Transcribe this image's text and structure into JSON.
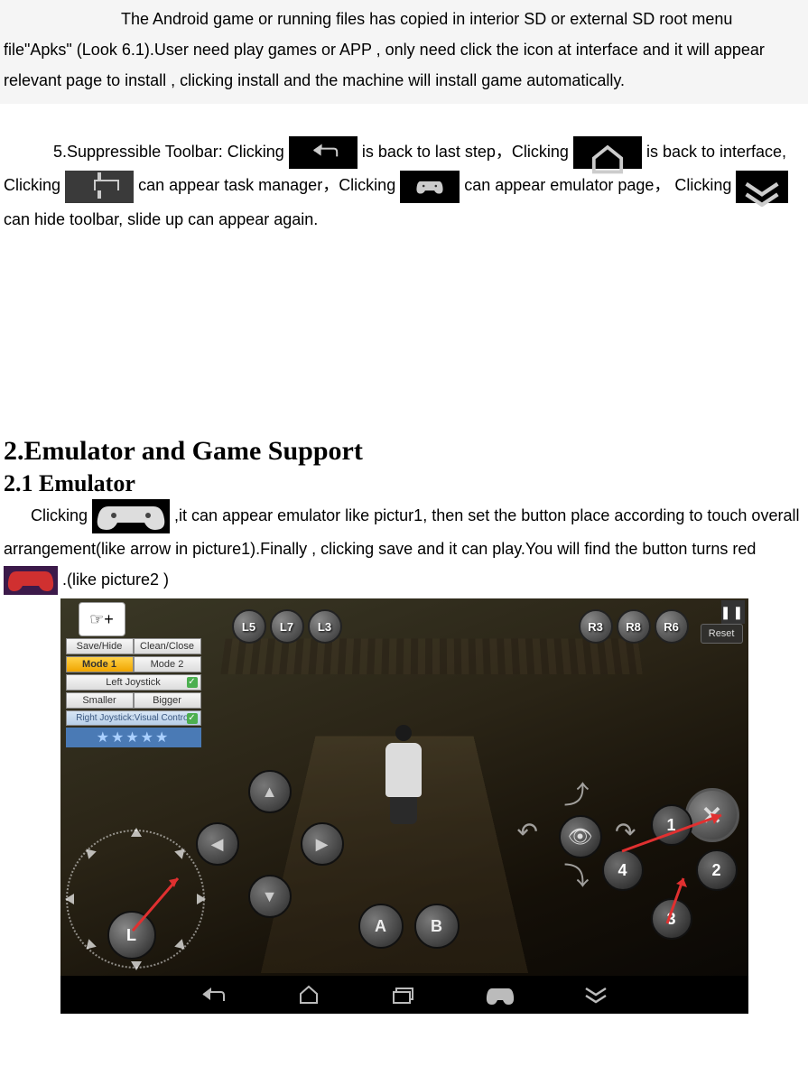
{
  "para1": "The Android game or running files has copied in interior SD or external SD root menu file\"Apks\" (Look 6.1).User need play games or APP , only need click the icon at interface and it will appear relevant page to install , clicking install and the machine will install game automatically.",
  "toolbar": {
    "prefix": "5.Suppressible Toolbar: Clicking",
    "after_back": " is back to last step，Clicking",
    "after_home": " is back to interface, Clicking",
    "after_tasks": " can appear task manager，Clicking ",
    "after_gamepad": " can appear emulator page， Clicking",
    "after_hide": " can hide toolbar, slide up can appear again."
  },
  "section_heading": "2.Emulator and Game Support",
  "subsection_heading": "2.1 Emulator",
  "para3": {
    "p1": "Clicking ",
    "p2": " ,it can appear emulator like pictur1, then set the button place according to touch   overall arrangement(like arrow in picture1).Finally , clicking save and it can play.You will find the button turns red",
    "p3": ".(like picture2 )"
  },
  "emulator_panel": {
    "save_hide": "Save/Hide",
    "clean_close": "Clean/Close",
    "mode1": "Mode 1",
    "mode2": "Mode 2",
    "left_joystick": "Left Joystick",
    "smaller": "Smaller",
    "bigger": "Bigger",
    "right_joystick": "Right Joystick:Visual Control",
    "stars": "★★★★★"
  },
  "orbs": {
    "L5": "L5",
    "L7": "L7",
    "L3": "L3",
    "R3": "R3",
    "R8": "R8",
    "R6": "R6"
  },
  "buttons": {
    "reset": "Reset",
    "A": "A",
    "B": "B",
    "L": "L",
    "n1": "1",
    "n2": "2",
    "n3": "3",
    "n4": "4",
    "X": "✕",
    "pause": "❚❚"
  },
  "drag_plus": "☞+"
}
